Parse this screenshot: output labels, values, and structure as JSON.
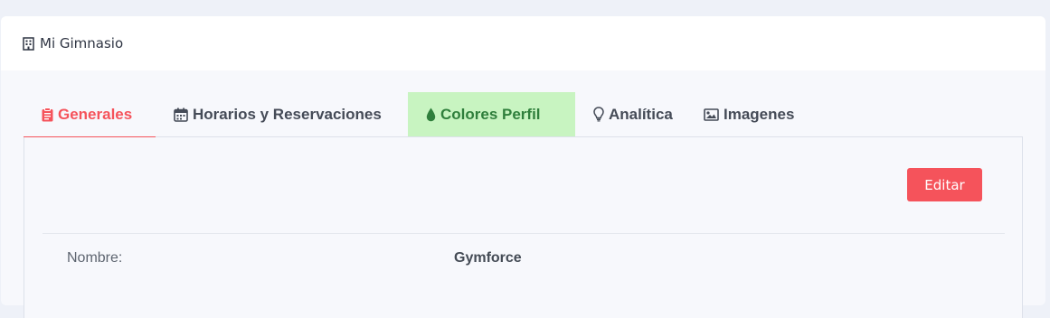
{
  "card": {
    "title": "Mi Gimnasio",
    "title_icon": "building-icon"
  },
  "tabs": [
    {
      "label": "Generales",
      "icon": "clipboard-icon",
      "state": "active"
    },
    {
      "label": "Horarios y Reservaciones",
      "icon": "calendar-icon",
      "state": "normal"
    },
    {
      "label": "Colores Perfil",
      "icon": "droplet-icon",
      "state": "highlighted"
    },
    {
      "label": "Analítica",
      "icon": "lightbulb-icon",
      "state": "normal"
    },
    {
      "label": "Imagenes",
      "icon": "image-icon",
      "state": "normal"
    }
  ],
  "panel": {
    "edit_label": "Editar",
    "fields": [
      {
        "label": "Nombre:",
        "value": "Gymforce"
      }
    ]
  },
  "colors": {
    "accent": "#f5535b",
    "highlight_bg": "#c8f4c1",
    "highlight_text": "#2f7f3c",
    "page_bg": "#eef1f8"
  }
}
